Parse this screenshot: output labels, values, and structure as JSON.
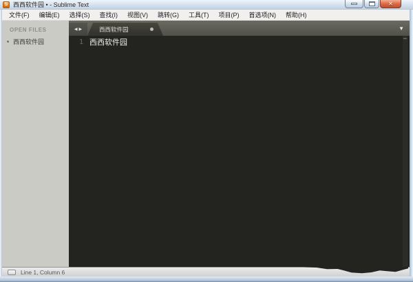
{
  "window": {
    "title": "西西软件园 • - Sublime Text",
    "app_icon_letter": "S"
  },
  "icons": {
    "close": "✕",
    "tab_scroll_left": "◀",
    "tab_scroll_right": "▶",
    "tab_overflow": "▼"
  },
  "menu": {
    "items": [
      "文件(F)",
      "编辑(E)",
      "选择(S)",
      "查找(I)",
      "视图(V)",
      "跳转(G)",
      "工具(T)",
      "项目(P)",
      "首选项(N)",
      "帮助(H)"
    ]
  },
  "sidebar": {
    "header": "OPEN FILES",
    "files": [
      {
        "name": "西西软件园",
        "modified": true
      }
    ]
  },
  "tabbar": {
    "tabs": [
      {
        "label": "西西软件园",
        "modified": true
      }
    ]
  },
  "editor": {
    "lines": [
      {
        "number": "1",
        "text": "西西软件园"
      }
    ]
  },
  "status": {
    "text": "Line 1, Column 6"
  },
  "colors": {
    "editor_bg": "#232420",
    "tabbar_bg": "#5c5c54",
    "tab_active_bg": "#3c3c36",
    "sidebar_bg": "#cbcbc5",
    "titlebar_tint": "#cfdcea",
    "close_button_red": "#c14d2d",
    "app_icon_orange": "#e07c16"
  }
}
